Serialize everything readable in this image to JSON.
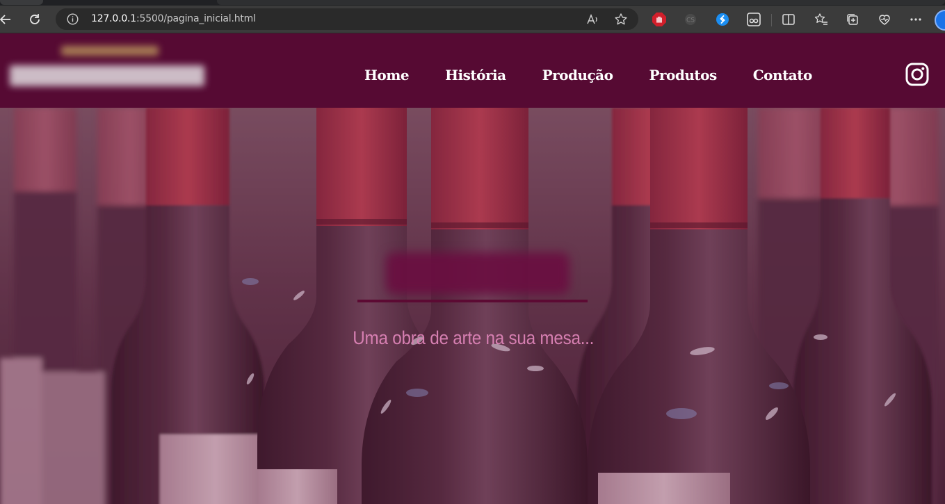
{
  "browser": {
    "url_host": "127.0.0.1",
    "url_rest": ":5500/pagina_inicial.html",
    "icons": {
      "back": "back-arrow-icon",
      "refresh": "refresh-icon",
      "site_info": "info-icon",
      "read_aloud": "read-aloud-icon",
      "favorite": "star-icon",
      "extensions": [
        "adblock-extension-icon",
        "cs-extension-icon",
        "shazam-extension-icon",
        "glasses-extension-icon"
      ],
      "split": "split-screen-icon",
      "favorites": "favorites-icon",
      "collections": "collections-icon",
      "health": "browser-essentials-icon",
      "menu": "more-menu-icon"
    }
  },
  "site": {
    "nav": [
      "Home",
      "História",
      "Produção",
      "Produtos",
      "Contato"
    ],
    "social_icon": "instagram-icon",
    "hero": {
      "tagline": "Uma obra de arte na sua mesa..."
    },
    "colors": {
      "brand": "#560a33",
      "tagline": "#d67fb1",
      "accent_line": "#5c0a33"
    }
  }
}
